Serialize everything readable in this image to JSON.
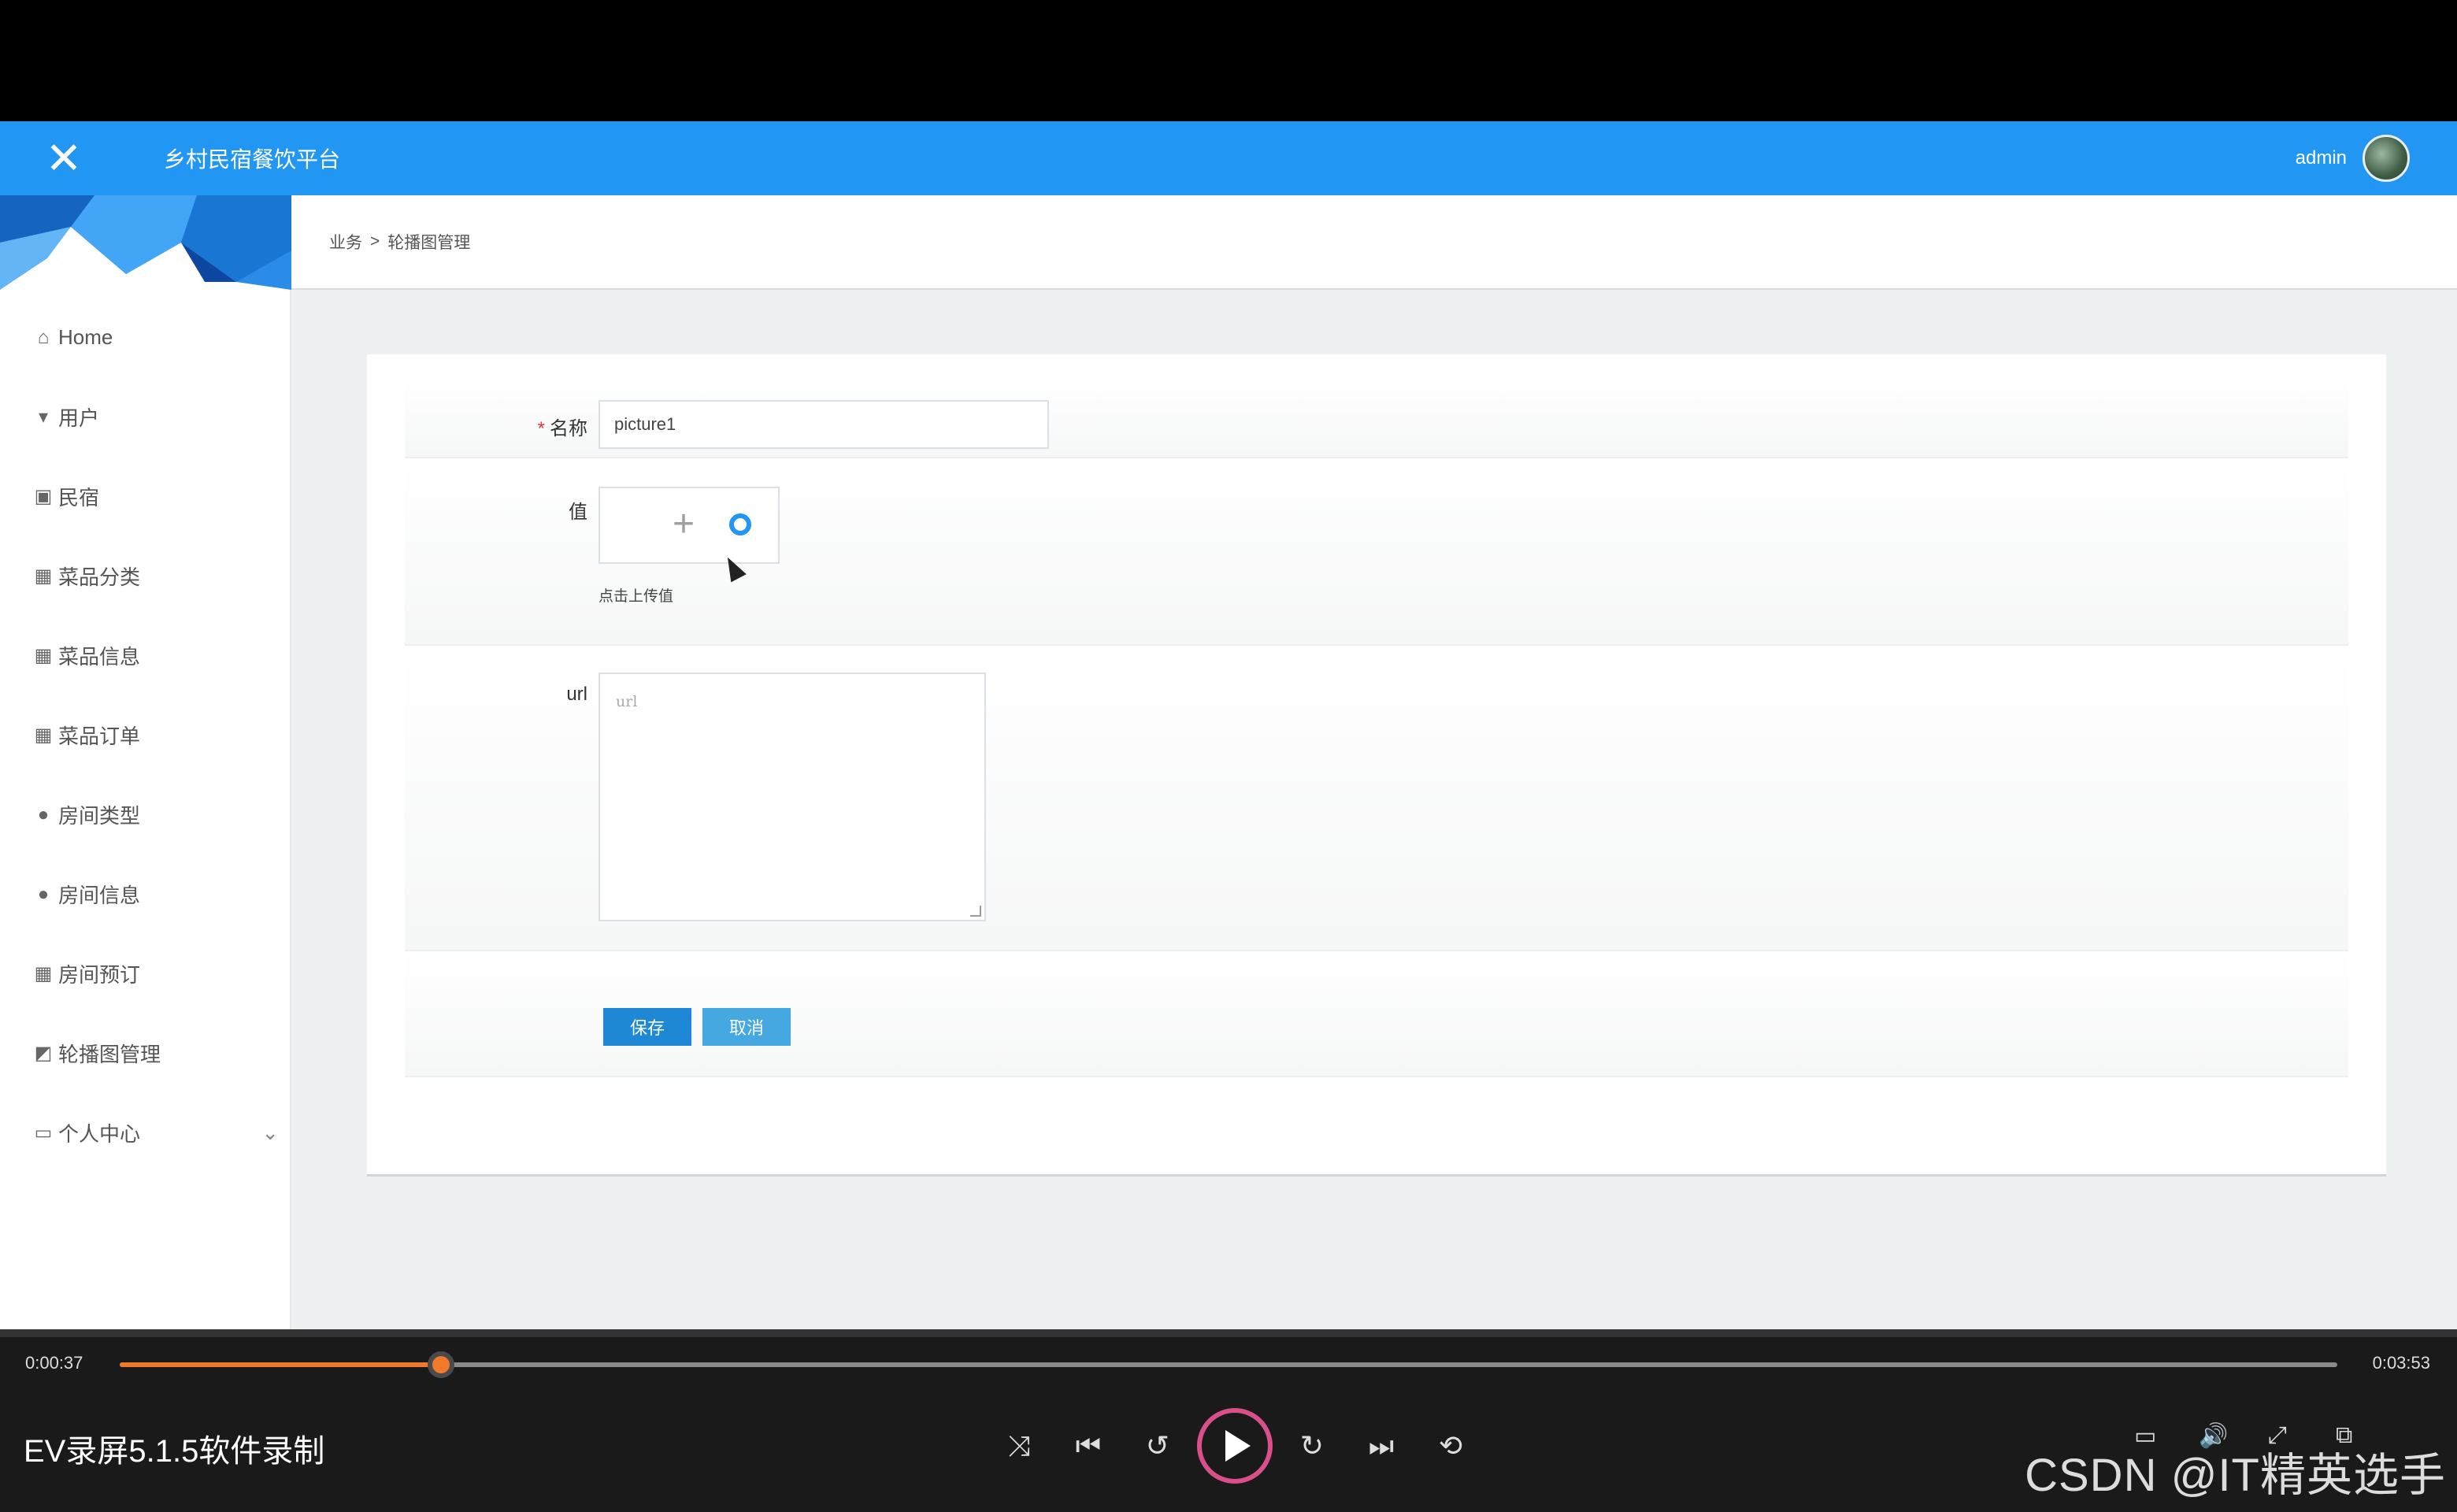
{
  "app": {
    "title": "乡村民宿餐饮平台",
    "user": "admin"
  },
  "breadcrumb": {
    "parent": "业务",
    "separator": ">",
    "current": "轮播图管理"
  },
  "sidebar": {
    "items": [
      {
        "label": "Home",
        "icon": "home-icon"
      },
      {
        "label": "用户",
        "icon": "user-icon"
      },
      {
        "label": "民宿",
        "icon": "clipboard-icon"
      },
      {
        "label": "菜品分类",
        "icon": "grid-icon"
      },
      {
        "label": "菜品信息",
        "icon": "grid-icon"
      },
      {
        "label": "菜品订单",
        "icon": "grid-icon"
      },
      {
        "label": "房间类型",
        "icon": "person-icon"
      },
      {
        "label": "房间信息",
        "icon": "person-icon"
      },
      {
        "label": "房间预订",
        "icon": "grid-icon"
      },
      {
        "label": "轮播图管理",
        "icon": "chart-icon"
      },
      {
        "label": "个人中心",
        "icon": "card-icon"
      }
    ]
  },
  "form": {
    "name": {
      "label": "名称",
      "required_mark": "*",
      "value": "picture1"
    },
    "value": {
      "label": "值",
      "hint": "点击上传值"
    },
    "url": {
      "label": "url",
      "placeholder": "url"
    },
    "save_label": "保存",
    "cancel_label": "取消"
  },
  "player": {
    "current_time": "0:00:37",
    "total_time": "0:03:53",
    "progress_fraction": 0.145,
    "brand": "EV录屏5.1.5软件录制",
    "accent": "#f07a2a"
  },
  "watermark": "CSDN @IT精英选手"
}
